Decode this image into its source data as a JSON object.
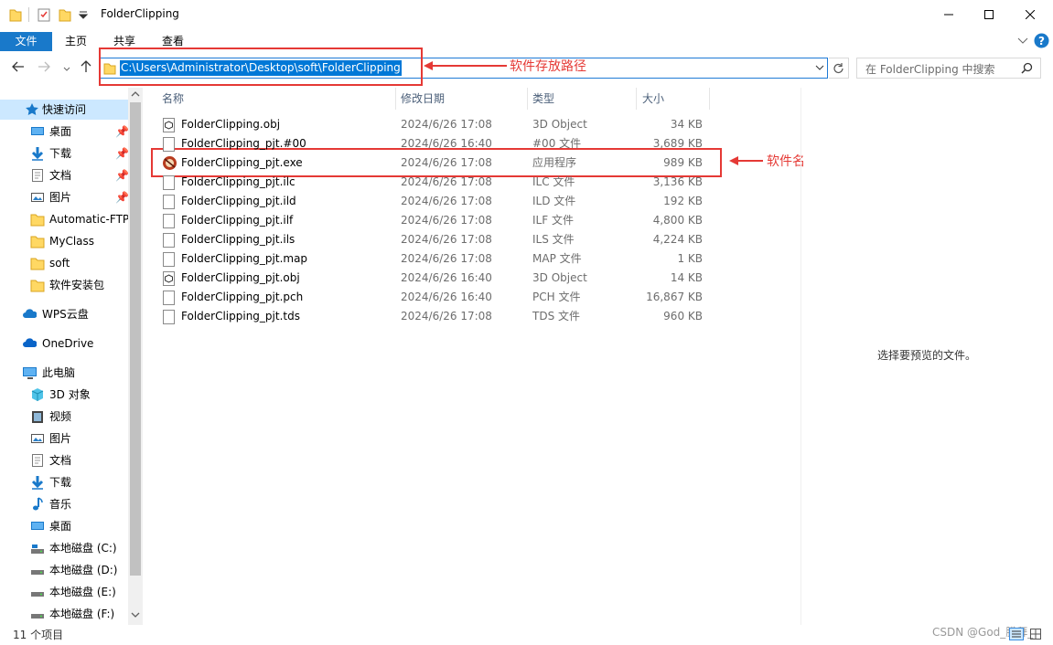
{
  "window": {
    "title": "FolderClipping"
  },
  "ribbon": {
    "tabs": [
      "文件",
      "主页",
      "共享",
      "查看"
    ]
  },
  "address": {
    "path": "C:\\Users\\Administrator\\Desktop\\soft\\FolderClipping"
  },
  "search": {
    "placeholder": "在 FolderClipping 中搜索"
  },
  "annotations": {
    "path_label": "软件存放路径",
    "name_label": "软件名"
  },
  "sidebar": {
    "quick_access": "快速访问",
    "quick_items": [
      "桌面",
      "下载",
      "文档",
      "图片",
      "Automatic-FTP_",
      "MyClass",
      "soft",
      "软件安装包"
    ],
    "wps": "WPS云盘",
    "onedrive": "OneDrive",
    "this_pc": "此电脑",
    "pc_items": [
      "3D 对象",
      "视频",
      "图片",
      "文档",
      "下载",
      "音乐",
      "桌面",
      "本地磁盘 (C:)",
      "本地磁盘 (D:)",
      "本地磁盘 (E:)",
      "本地磁盘 (F:)"
    ]
  },
  "columns": {
    "name": "名称",
    "date": "修改日期",
    "type": "类型",
    "size": "大小"
  },
  "files": [
    {
      "name": "FolderClipping.obj",
      "date": "2024/6/26 17:08",
      "type": "3D Object",
      "size": "34 KB",
      "icon": "3d-object-icon"
    },
    {
      "name": "FolderClipping_pjt.#00",
      "date": "2024/6/26 16:40",
      "type": "#00 文件",
      "size": "3,689 KB",
      "icon": "file-icon"
    },
    {
      "name": "FolderClipping_pjt.exe",
      "date": "2024/6/26 17:08",
      "type": "应用程序",
      "size": "989 KB",
      "icon": "app-icon"
    },
    {
      "name": "FolderClipping_pjt.ilc",
      "date": "2024/6/26 17:08",
      "type": "ILC 文件",
      "size": "3,136 KB",
      "icon": "file-icon"
    },
    {
      "name": "FolderClipping_pjt.ild",
      "date": "2024/6/26 17:08",
      "type": "ILD 文件",
      "size": "192 KB",
      "icon": "file-icon"
    },
    {
      "name": "FolderClipping_pjt.ilf",
      "date": "2024/6/26 17:08",
      "type": "ILF 文件",
      "size": "4,800 KB",
      "icon": "file-icon"
    },
    {
      "name": "FolderClipping_pjt.ils",
      "date": "2024/6/26 17:08",
      "type": "ILS 文件",
      "size": "4,224 KB",
      "icon": "file-icon"
    },
    {
      "name": "FolderClipping_pjt.map",
      "date": "2024/6/26 17:08",
      "type": "MAP 文件",
      "size": "1 KB",
      "icon": "file-icon"
    },
    {
      "name": "FolderClipping_pjt.obj",
      "date": "2024/6/26 16:40",
      "type": "3D Object",
      "size": "14 KB",
      "icon": "3d-object-icon"
    },
    {
      "name": "FolderClipping_pjt.pch",
      "date": "2024/6/26 16:40",
      "type": "PCH 文件",
      "size": "16,867 KB",
      "icon": "file-icon"
    },
    {
      "name": "FolderClipping_pjt.tds",
      "date": "2024/6/26 17:08",
      "type": "TDS 文件",
      "size": "960 KB",
      "icon": "file-icon"
    }
  ],
  "preview": {
    "text": "选择要预览的文件。"
  },
  "status": {
    "count": "11 个项目"
  },
  "watermark": "CSDN @God_膜拜_"
}
